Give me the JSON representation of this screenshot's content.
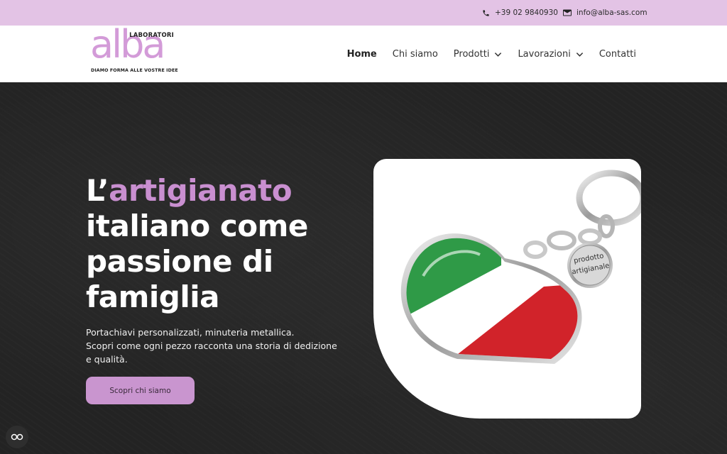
{
  "topbar": {
    "phone": "+39 02 9840930",
    "email": "info@alba-sas.com",
    "background": "#e3c3e5"
  },
  "logo": {
    "word": "alba",
    "top_label": "LABORATORI",
    "tagline": "DIAMO FORMA ALLE VOSTRE IDEE",
    "color": "#d39bd8"
  },
  "nav": {
    "items": [
      {
        "label": "Home",
        "active": true
      },
      {
        "label": "Chi siamo"
      },
      {
        "label": "Prodotti",
        "has_dropdown": true
      },
      {
        "label": "Lavorazioni",
        "has_dropdown": true
      },
      {
        "label": "Contatti"
      }
    ]
  },
  "hero": {
    "headline_pre": "L’",
    "headline_accent": "artigianato",
    "headline_rest": "italiano come passione di famiglia",
    "subtext_line1": "Portachiavi personalizzati, minuteria metallica.",
    "subtext_line2": "Scopri come ogni pezzo racconta una storia di dedizione e qualità.",
    "cta_label": "Scopri chi siamo",
    "accent_color": "#c98fd0",
    "image": {
      "subject": "heart-keychain-italian-flag",
      "medallion_text_1": "prodotto",
      "medallion_text_2": "artigianale"
    }
  },
  "cookie": {
    "icon": "cookie-settings-icon"
  }
}
